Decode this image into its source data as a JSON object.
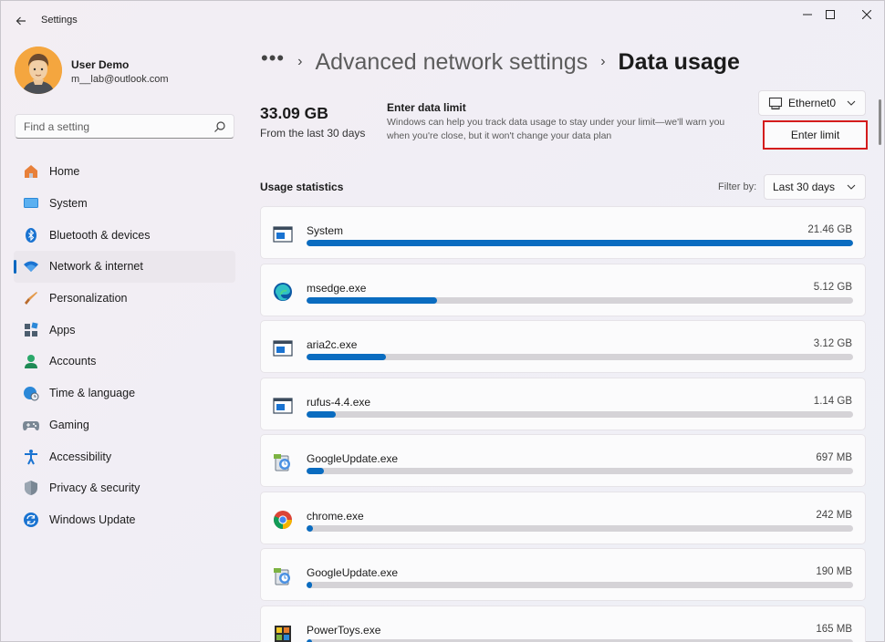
{
  "window": {
    "title": "Settings"
  },
  "user": {
    "name": "User Demo",
    "email": "m__lab@outlook.com"
  },
  "search": {
    "placeholder": "Find a setting"
  },
  "nav": {
    "items": [
      {
        "label": "Home",
        "icon": "home-icon"
      },
      {
        "label": "System",
        "icon": "system-icon"
      },
      {
        "label": "Bluetooth & devices",
        "icon": "bluetooth-icon"
      },
      {
        "label": "Network & internet",
        "icon": "wifi-icon",
        "active": true
      },
      {
        "label": "Personalization",
        "icon": "brush-icon"
      },
      {
        "label": "Apps",
        "icon": "apps-icon"
      },
      {
        "label": "Accounts",
        "icon": "accounts-icon"
      },
      {
        "label": "Time & language",
        "icon": "globe-clock-icon"
      },
      {
        "label": "Gaming",
        "icon": "gamepad-icon"
      },
      {
        "label": "Accessibility",
        "icon": "accessibility-icon"
      },
      {
        "label": "Privacy & security",
        "icon": "shield-icon"
      },
      {
        "label": "Windows Update",
        "icon": "update-icon"
      }
    ]
  },
  "breadcrumb": {
    "more": "•••",
    "parent": "Advanced network settings",
    "current": "Data usage"
  },
  "summary": {
    "total": "33.09 GB",
    "period": "From the last 30 days"
  },
  "limit": {
    "title": "Enter data limit",
    "description": "Windows can help you track data usage to stay under your limit—we'll warn you when you're close, but it won't change your data plan",
    "button": "Enter limit"
  },
  "adapter": {
    "selected": "Ethernet0"
  },
  "usage": {
    "title": "Usage statistics",
    "filter_label": "Filter by:",
    "filter_value": "Last 30 days",
    "items": [
      {
        "name": "System",
        "size": "21.46 GB",
        "fraction": 1.0,
        "icon": "app-window-icon"
      },
      {
        "name": "msedge.exe",
        "size": "5.12 GB",
        "fraction": 0.239,
        "icon": "edge-icon"
      },
      {
        "name": "aria2c.exe",
        "size": "3.12 GB",
        "fraction": 0.145,
        "icon": "app-window-icon"
      },
      {
        "name": "rufus-4.4.exe",
        "size": "1.14 GB",
        "fraction": 0.053,
        "icon": "app-window-icon"
      },
      {
        "name": "GoogleUpdate.exe",
        "size": "697 MB",
        "fraction": 0.032,
        "icon": "google-update-icon"
      },
      {
        "name": "chrome.exe",
        "size": "242 MB",
        "fraction": 0.011,
        "icon": "chrome-icon"
      },
      {
        "name": "GoogleUpdate.exe",
        "size": "190 MB",
        "fraction": 0.009,
        "icon": "google-update-icon"
      },
      {
        "name": "PowerToys.exe",
        "size": "165 MB",
        "fraction": 0.008,
        "icon": "powertoys-icon"
      }
    ]
  },
  "colors": {
    "accent": "#0a6cc0",
    "highlight_border": "#d41c1c"
  }
}
